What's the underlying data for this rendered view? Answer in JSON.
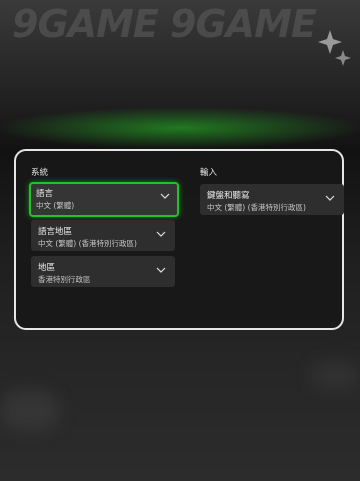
{
  "watermark": {
    "text": "9GAME 9GAME"
  },
  "colors": {
    "focus": "#22c22a",
    "panel_border": "#e6e6e6",
    "dropdown_bg": "#2e2e2e"
  },
  "system": {
    "title": "系統",
    "language": {
      "label": "語言",
      "value": "中文 (繁體)"
    },
    "language_region": {
      "label": "語言地區",
      "value": "中文 (繁體) (香港特別行政區)"
    },
    "region": {
      "label": "地區",
      "value": "香港特別行政區"
    }
  },
  "input": {
    "title": "輸入",
    "keyboard": {
      "label": "鍵盤和聽寫",
      "value": "中文 (繁體) (香港特別行政區)"
    }
  }
}
